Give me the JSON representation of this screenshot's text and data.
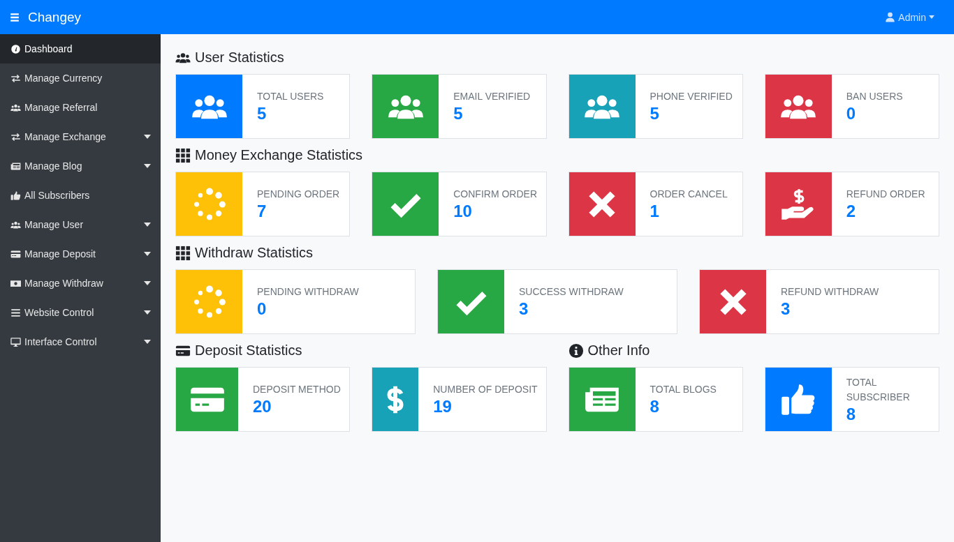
{
  "topbar": {
    "brand": "Changey",
    "user": "Admin"
  },
  "sidebar": {
    "items": [
      {
        "label": "Dashboard",
        "kind": "gauge",
        "submenu": false,
        "selected": true
      },
      {
        "label": "Manage Currency",
        "kind": "exchange",
        "submenu": false,
        "selected": false
      },
      {
        "label": "Manage Referral",
        "kind": "users",
        "submenu": false,
        "selected": false
      },
      {
        "label": "Manage Exchange",
        "kind": "exchange",
        "submenu": true,
        "selected": false
      },
      {
        "label": "Manage Blog",
        "kind": "newspaper",
        "submenu": true,
        "selected": false
      },
      {
        "label": "All Subscribers",
        "kind": "thumbs",
        "submenu": false,
        "selected": false
      },
      {
        "label": "Manage User",
        "kind": "users",
        "submenu": true,
        "selected": false
      },
      {
        "label": "Manage Deposit",
        "kind": "card",
        "submenu": true,
        "selected": false
      },
      {
        "label": "Manage Withdraw",
        "kind": "money",
        "submenu": true,
        "selected": false
      },
      {
        "label": "Website Control",
        "kind": "bars",
        "submenu": true,
        "selected": false
      },
      {
        "label": "Interface Control",
        "kind": "desktop",
        "submenu": true,
        "selected": false
      }
    ]
  },
  "sections": [
    {
      "title": "User Statistics",
      "kind": "users",
      "cards": [
        {
          "label": "TOTAL USERS",
          "value": "5",
          "kind": "users",
          "color": "#007bff"
        },
        {
          "label": "EMAIL VERIFIED",
          "value": "5",
          "kind": "users",
          "color": "#28a745"
        },
        {
          "label": "PHONE VERIFIED",
          "value": "5",
          "kind": "users",
          "color": "#17a2b8"
        },
        {
          "label": "BAN USERS",
          "value": "0",
          "kind": "users",
          "color": "#dc3545"
        }
      ]
    },
    {
      "title": "Money Exchange Statistics",
      "kind": "grid",
      "cards": [
        {
          "label": "PENDING ORDER",
          "value": "7",
          "kind": "spinner",
          "color": "#ffc107"
        },
        {
          "label": "CONFIRM ORDER",
          "value": "10",
          "kind": "check",
          "color": "#28a745"
        },
        {
          "label": "ORDER CANCEL",
          "value": "1",
          "kind": "times",
          "color": "#dc3545"
        },
        {
          "label": "REFUND ORDER",
          "value": "2",
          "kind": "refund",
          "color": "#dc3545"
        }
      ]
    },
    {
      "title": "Withdraw Statistics",
      "kind": "grid",
      "cards": [
        {
          "label": "PENDING WITHDRAW",
          "value": "0",
          "kind": "spinner",
          "color": "#ffc107"
        },
        {
          "label": "SUCCESS WITHDRAW",
          "value": "3",
          "kind": "check",
          "color": "#28a745"
        },
        {
          "label": "REFUND WITHDRAW",
          "value": "3",
          "kind": "times",
          "color": "#dc3545"
        }
      ]
    }
  ],
  "half_sections": [
    {
      "title": "Deposit Statistics",
      "kind": "card",
      "cards": [
        {
          "label": "DEPOSIT METHOD",
          "value": "20",
          "kind": "card",
          "color": "#28a745"
        },
        {
          "label": "NUMBER OF DEPOSIT",
          "value": "19",
          "kind": "dollar",
          "color": "#17a2b8"
        }
      ]
    },
    {
      "title": "Other Info",
      "kind": "info",
      "cards": [
        {
          "label": "TOTAL BLOGS",
          "value": "8",
          "kind": "newspaper",
          "color": "#28a745"
        },
        {
          "label": "TOTAL SUBSCRIBER",
          "value": "8",
          "kind": "thumbs",
          "color": "#007bff"
        }
      ]
    }
  ]
}
